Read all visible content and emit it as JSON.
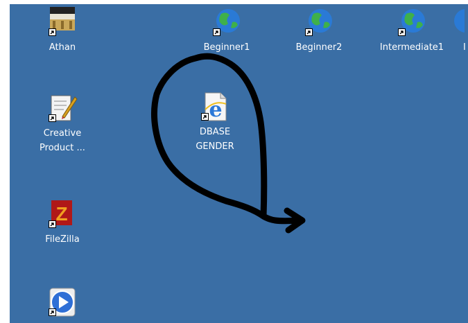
{
  "colors": {
    "desktop": "#3a6ea5",
    "label": "#ffffff",
    "ink": "#000000"
  },
  "icons": [
    {
      "label": "Athan",
      "icon": "athan-app-icon"
    },
    {
      "label": "Creative\nProduct ...",
      "icon": "creative-product-icon"
    },
    {
      "label": "FileZilla",
      "icon": "filezilla-icon"
    },
    {
      "label": "",
      "icon": "media-player-icon"
    },
    {
      "label": "Beginner1",
      "icon": "globe-icon"
    },
    {
      "label": "Beginner2",
      "icon": "globe-icon"
    },
    {
      "label": "Intermediate1",
      "icon": "globe-icon"
    },
    {
      "label": "I",
      "icon": "globe-icon"
    },
    {
      "label": "DBASE\nGENDER",
      "icon": "internet-explorer-icon"
    }
  ]
}
